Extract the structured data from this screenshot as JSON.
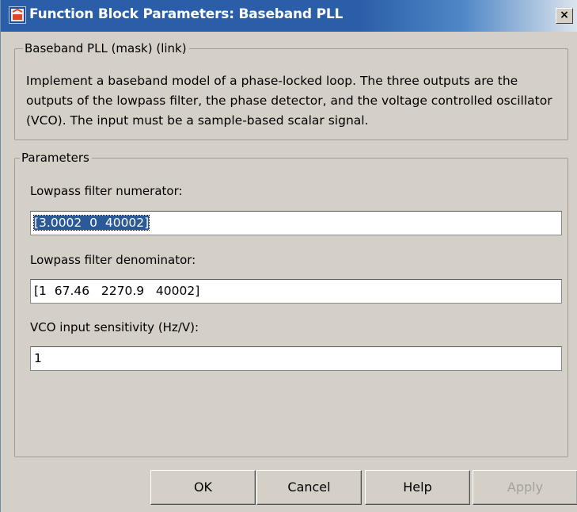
{
  "window": {
    "title": "Function Block Parameters: Baseband PLL",
    "close_label": "×"
  },
  "mask": {
    "group_label": "Baseband PLL (mask) (link)",
    "description": "Implement a baseband model of a phase-locked loop.  The three outputs are the outputs of the lowpass filter, the phase detector, and the voltage controlled oscillator (VCO).  The input must be a sample-based scalar signal."
  },
  "parameters": {
    "group_label": "Parameters",
    "fields": [
      {
        "label": "Lowpass filter numerator:",
        "value": "[3.0002  0  40002]",
        "selected": true
      },
      {
        "label": "Lowpass filter denominator:",
        "value": "[1  67.46   2270.9   40002]",
        "selected": false
      },
      {
        "label": "VCO input sensitivity (Hz/V):",
        "value": "1",
        "selected": false
      }
    ]
  },
  "buttons": {
    "ok": "OK",
    "cancel": "Cancel",
    "help": "Help",
    "apply": "Apply"
  },
  "colors": {
    "title_bar": "#2a5ea8",
    "dialog_bg": "#d4d0c8",
    "selection": "#2c5997"
  }
}
